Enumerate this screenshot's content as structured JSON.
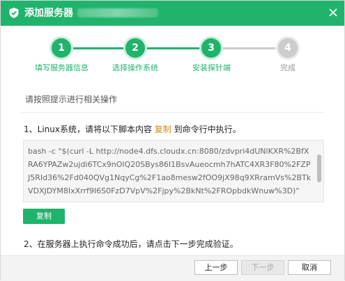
{
  "dialog": {
    "title": "添加服务器",
    "close_icon": "close-icon",
    "logo_icon": "shield-logo-icon"
  },
  "steps": [
    {
      "number": "1",
      "label": "填写服务器信息",
      "state": "done"
    },
    {
      "number": "2",
      "label": "选择操作系统",
      "state": "done"
    },
    {
      "number": "3",
      "label": "安装探针端",
      "state": "active"
    },
    {
      "number": "4",
      "label": "完成",
      "state": "inactive"
    }
  ],
  "hint": "请按照提示进行相关操作",
  "instruction1": {
    "prefix": "1、Linux系统，请将以下脚本内容 ",
    "link": "复制",
    "suffix": " 到命令行中执行。"
  },
  "command": "bash -c \"$(curl -L http://node4.dfs.cloudx.cn:8080/zdvpri4dUNlKXR%2BfXRA6YPAZw2ujdi6TCx9nOlQ20SBys86I1BsvAueocmh7hATC4XR3F80%2FZPJ5RId36%2Fd040QVg1NqyCg%2F1ao8mesw2fOO9jX98q9XRramVs%2BTkVDXJDYM8IxXrrf9I6S0FzD7VpV%2Fjpy%2BkNt%2FROpbdkWnuw%3D)\"",
  "copy_button": "复制",
  "instruction2": "2、在服务器上执行命令成功后，请点击下一步完成验证。",
  "footer": {
    "prev": "上一步",
    "next": "下一步",
    "cancel": "取消"
  },
  "colors": {
    "brand": "#20b36b",
    "inactive": "#cccccc",
    "link": "#d48a10"
  }
}
